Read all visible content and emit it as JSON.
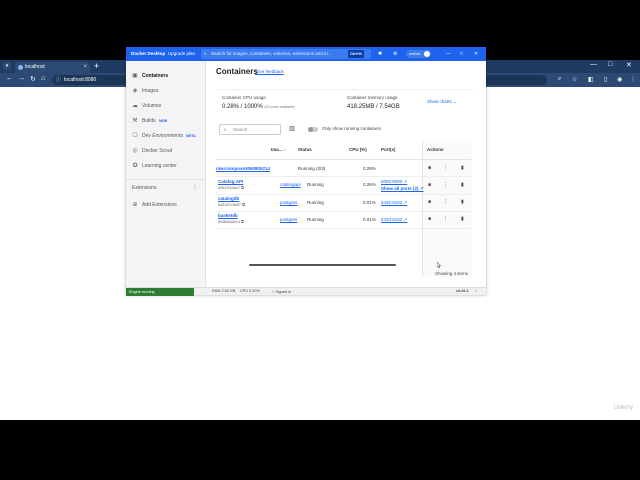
{
  "browser": {
    "tab_title": "localhost",
    "new_tab_glyph": "+",
    "address": "localhost:8080",
    "nav": {
      "back": "←",
      "forward": "→",
      "reload": "↻",
      "home": "⌂"
    },
    "window_controls": {
      "minimize": "—",
      "maximize": "□",
      "close": "✕"
    }
  },
  "docker": {
    "brand": "Docker Desktop",
    "upgrade": "Upgrade plan",
    "search_placeholder": "Search for images, containers, volumes, extensions and m...",
    "search_shortcut": "Ctrl+K",
    "user": "mehm...",
    "sidebar": {
      "items": [
        {
          "label": "Containers",
          "icon": "containers-icon",
          "glyph": "▣"
        },
        {
          "label": "Images",
          "icon": "images-icon",
          "glyph": "◈"
        },
        {
          "label": "Volumes",
          "icon": "volumes-icon",
          "glyph": "☁"
        },
        {
          "label": "Builds",
          "icon": "builds-icon",
          "glyph": "⚒",
          "badge": "NEW"
        },
        {
          "label": "Dev Environments",
          "icon": "dev-env-icon",
          "glyph": "⎔",
          "badge": "BETA"
        },
        {
          "label": "Docker Scout",
          "icon": "scout-icon",
          "glyph": "◎"
        },
        {
          "label": "Learning center",
          "icon": "learning-icon",
          "glyph": "✪"
        }
      ],
      "extensions_label": "Extensions",
      "add_extensions": "Add Extensions"
    },
    "main": {
      "title": "Containers",
      "feedback": "Give feedback",
      "cpu_label": "Container CPU usage",
      "cpu_value": "0.28% / 1000%",
      "cpu_note": "(10 cores available)",
      "mem_label": "Container memory usage",
      "mem_value": "418.25MB / 7.54GB",
      "show_charts": "Show charts",
      "search_placeholder": "Search",
      "toggle_label": "Only show running containers",
      "headers": {
        "name": "",
        "image": "Ima...",
        "status": "Status",
        "cpu": "CPU (%)",
        "ports": "Port(s)",
        "actions": "Actions"
      },
      "rows": [
        {
          "name": "ckercompose3050805214",
          "sub": "",
          "image": "",
          "status": "Running (3/3)",
          "cpu": "0.28%",
          "port": "",
          "port2": ""
        },
        {
          "name": "Catalog.API",
          "sub": "d061f7b4ac7",
          "image": "catalogapi",
          "status": "Running",
          "cpu": "0.26%",
          "port": "6000:8080",
          "port2": "Show all ports (2)"
        },
        {
          "name": "catalogdb",
          "sub": "848287c9b97",
          "image": "postgres",
          "status": "Running",
          "cpu": "0.01%",
          "port": "5432:5432",
          "port2": ""
        },
        {
          "name": "basketdb",
          "sub": "5fc8b5a6b14",
          "image": "postgres",
          "status": "Running",
          "cpu": "0.01%",
          "port": "5433:5432",
          "port2": ""
        }
      ],
      "footer": "Showing 4 items"
    },
    "statusbar": {
      "engine": "Engine running",
      "ram": "RAM 2.50 GB",
      "cpu": "CPU 0.20%",
      "signed": "Signed in",
      "version": "v4.26.1"
    }
  },
  "watermark": "Udemy"
}
